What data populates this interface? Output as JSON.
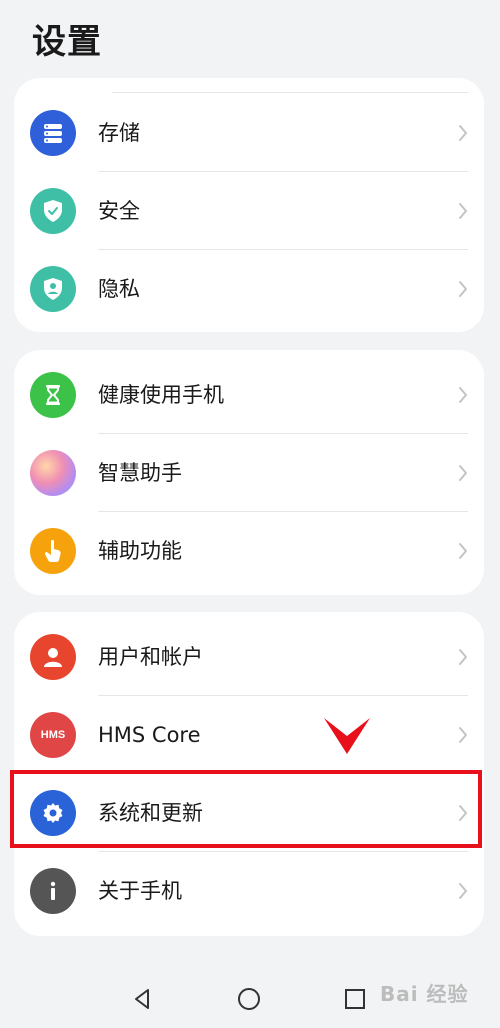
{
  "header": {
    "title": "设置"
  },
  "groups": [
    {
      "items": [
        {
          "label": "存储",
          "icon": "storage-icon",
          "color": "#2f5fd9"
        },
        {
          "label": "安全",
          "icon": "shield-check-icon",
          "color": "#3fbfa6"
        },
        {
          "label": "隐私",
          "icon": "privacy-shield-icon",
          "color": "#3fbfa6"
        }
      ]
    },
    {
      "items": [
        {
          "label": "健康使用手机",
          "icon": "hourglass-icon",
          "color": "#3cc248"
        },
        {
          "label": "智慧助手",
          "icon": "assistant-orb-icon",
          "color": "#c58de6"
        },
        {
          "label": "辅助功能",
          "icon": "hand-pointer-icon",
          "color": "#f5a20d"
        }
      ]
    },
    {
      "items": [
        {
          "label": "用户和帐户",
          "icon": "user-icon",
          "color": "#e8452f"
        },
        {
          "label": "HMS Core",
          "icon": "hms-icon",
          "color": "#e04646",
          "icon_text": "HMS"
        },
        {
          "label": "系统和更新",
          "icon": "gear-icon",
          "color": "#2a62d8"
        },
        {
          "label": "关于手机",
          "icon": "info-icon",
          "color": "#555555"
        }
      ]
    }
  ],
  "annotation": {
    "highlight_color": "#e8101a"
  },
  "nav": {
    "back": "back-icon",
    "home": "home-icon",
    "recents": "recents-icon"
  },
  "watermark": {
    "text": "Bai 经验"
  }
}
